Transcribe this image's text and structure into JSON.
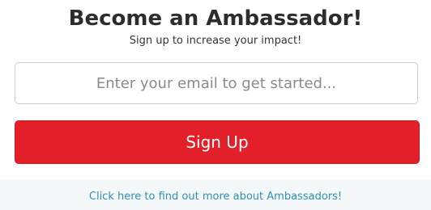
{
  "header": {
    "title": "Become an Ambassador!",
    "subtitle": "Sign up to increase your impact!"
  },
  "form": {
    "email_placeholder": "Enter your email to get started...",
    "email_value": "",
    "signup_label": "Sign Up"
  },
  "footer": {
    "link_text": "Click here to find out more about Ambassadors!"
  },
  "colors": {
    "accent": "#e3202a",
    "link": "#2e90b8",
    "title": "#2d2d2d",
    "info_bar_bg": "#f4f8f8"
  }
}
